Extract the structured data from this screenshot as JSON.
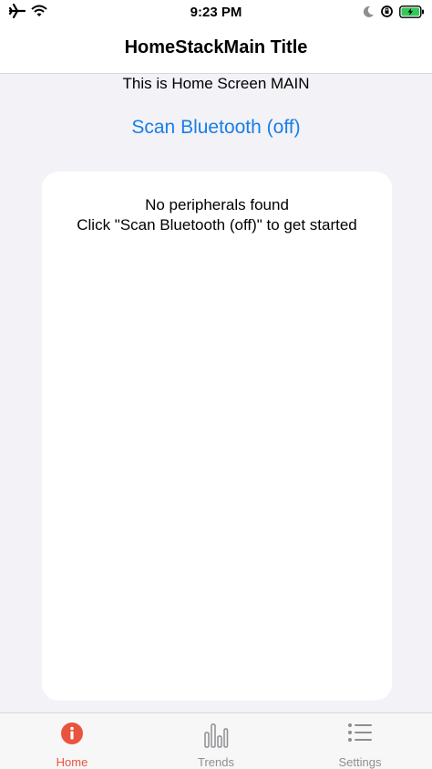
{
  "status_bar": {
    "time": "9:23 PM",
    "left_icons": [
      "airplane-icon",
      "wifi-icon"
    ],
    "right_icons": [
      "moon-icon",
      "orientation-lock-icon",
      "battery-charging-icon"
    ]
  },
  "nav": {
    "title": "HomeStackMain Title"
  },
  "main": {
    "subtitle": "This is Home Screen MAIN",
    "scan_button_label": "Scan Bluetooth (off)",
    "empty_line1": "No peripherals found",
    "empty_line2": "Click \"Scan Bluetooth (off)\" to get started"
  },
  "tabs": [
    {
      "label": "Home",
      "icon": "info-icon",
      "active": true
    },
    {
      "label": "Trends",
      "icon": "bar-chart-icon",
      "active": false
    },
    {
      "label": "Settings",
      "icon": "list-icon",
      "active": false
    }
  ],
  "colors": {
    "accent_blue": "#1a7ee6",
    "active_tab": "#e8543e",
    "inactive_tab": "#8e8e93",
    "battery_green": "#34c759",
    "background": "#f2f2f7"
  }
}
